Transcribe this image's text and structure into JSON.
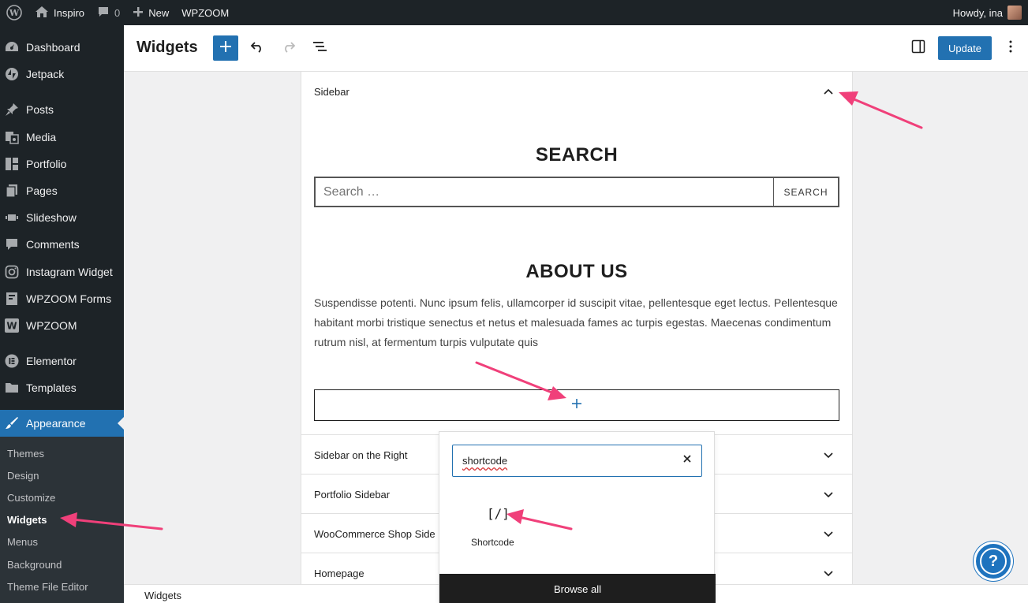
{
  "admin_bar": {
    "site_name": "Inspiro",
    "comments_count": "0",
    "new_label": "New",
    "plugin_label": "WPZOOM",
    "howdy": "Howdy, ina"
  },
  "sidebar": {
    "items": [
      {
        "label": "Dashboard",
        "icon": "dashboard-icon"
      },
      {
        "label": "Jetpack",
        "icon": "jetpack-icon"
      },
      {
        "label": "Posts",
        "icon": "pin-icon"
      },
      {
        "label": "Media",
        "icon": "media-icon"
      },
      {
        "label": "Portfolio",
        "icon": "portfolio-icon"
      },
      {
        "label": "Pages",
        "icon": "pages-icon"
      },
      {
        "label": "Slideshow",
        "icon": "slideshow-icon"
      },
      {
        "label": "Comments",
        "icon": "comments-icon"
      },
      {
        "label": "Instagram Widget",
        "icon": "instagram-icon"
      },
      {
        "label": "WPZOOM Forms",
        "icon": "forms-icon"
      },
      {
        "label": "WPZOOM",
        "icon": "wpzoom-icon"
      },
      {
        "label": "Elementor",
        "icon": "elementor-icon"
      },
      {
        "label": "Templates",
        "icon": "folder-icon"
      },
      {
        "label": "Appearance",
        "icon": "brush-icon"
      }
    ],
    "submenu": [
      "Themes",
      "Design",
      "Customize",
      "Widgets",
      "Menus",
      "Background",
      "Theme File Editor"
    ],
    "active_submenu": "Widgets"
  },
  "header": {
    "title": "Widgets",
    "update_label": "Update"
  },
  "widget_areas": [
    {
      "title": "Sidebar",
      "expanded": true
    },
    {
      "title": "Sidebar on the Right",
      "expanded": false
    },
    {
      "title": "Portfolio Sidebar",
      "expanded": false
    },
    {
      "title": "WooCommerce Shop Side",
      "expanded": false
    },
    {
      "title": "Homepage",
      "expanded": false
    }
  ],
  "search_widget": {
    "heading": "SEARCH",
    "placeholder": "Search …",
    "button_label": "SEARCH"
  },
  "about_widget": {
    "heading": "ABOUT US",
    "text": "Suspendisse potenti. Nunc ipsum felis, ullamcorper id suscipit vitae, pellentesque eget lectus. Pellentesque habitant morbi tristique senectus et netus et malesuada fames ac turpis egestas. Maecenas condimentum rutrum nisl, at fermentum turpis vulputate quis"
  },
  "inserter": {
    "search_value": "shortcode",
    "result_icon": "[/]",
    "result_label": "Shortcode",
    "browse_all": "Browse all"
  },
  "footer": {
    "breadcrumb": "Widgets"
  },
  "help": {
    "symbol": "?"
  },
  "colors": {
    "admin_dark": "#1d2327",
    "accent": "#2271b1",
    "annotation_arrow": "#f0407a"
  }
}
